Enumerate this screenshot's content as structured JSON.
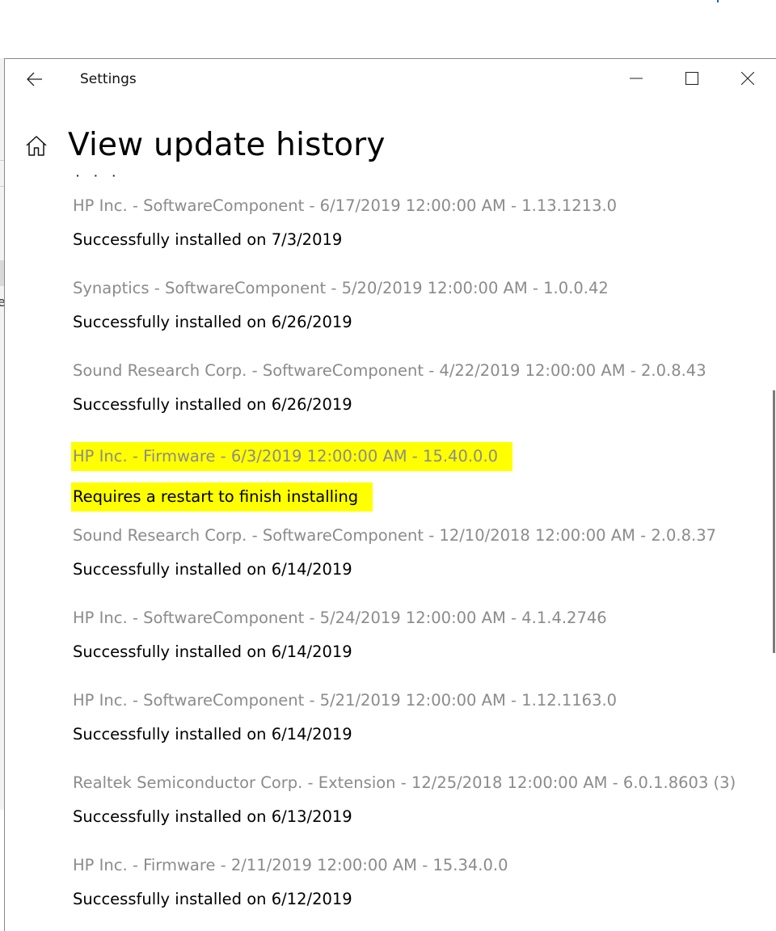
{
  "window": {
    "title": "Settings",
    "page_title": "View update history"
  },
  "highlight_color": "#ffff00",
  "updates": [
    {
      "title": "HP Inc. - SoftwareComponent - 6/17/2019 12:00:00 AM - 1.13.1213.0",
      "status": "Successfully installed on 7/3/2019",
      "highlighted": false
    },
    {
      "title": "Synaptics - SoftwareComponent - 5/20/2019 12:00:00 AM - 1.0.0.42",
      "status": "Successfully installed on 6/26/2019",
      "highlighted": false
    },
    {
      "title": "Sound Research Corp. - SoftwareComponent - 4/22/2019 12:00:00 AM - 2.0.8.43",
      "status": "Successfully installed on 6/26/2019",
      "highlighted": false
    },
    {
      "title": "HP Inc. - Firmware - 6/3/2019 12:00:00 AM - 15.40.0.0",
      "status": "Requires a restart to finish installing",
      "highlighted": true
    },
    {
      "title": "Sound Research Corp. - SoftwareComponent - 12/10/2018 12:00:00 AM - 2.0.8.37",
      "status": "Successfully installed on 6/14/2019",
      "highlighted": false
    },
    {
      "title": "HP Inc. - SoftwareComponent - 5/24/2019 12:00:00 AM - 4.1.4.2746",
      "status": "Successfully installed on 6/14/2019",
      "highlighted": false
    },
    {
      "title": "HP Inc. - SoftwareComponent - 5/21/2019 12:00:00 AM - 1.12.1163.0",
      "status": "Successfully installed on 6/14/2019",
      "highlighted": false
    },
    {
      "title": "Realtek Semiconductor Corp. - Extension - 12/25/2018 12:00:00 AM - 6.0.1.8603 (3)",
      "status": "Successfully installed on 6/13/2019",
      "highlighted": false
    },
    {
      "title": "HP Inc. - Firmware - 2/11/2019 12:00:00 AM - 15.34.0.0",
      "status": "Successfully installed on 6/12/2019",
      "highlighted": false
    }
  ]
}
